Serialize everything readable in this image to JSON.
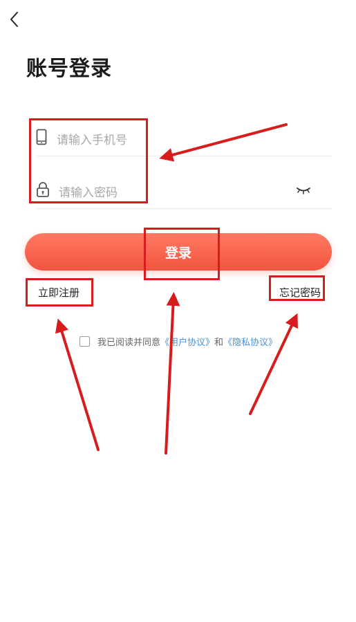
{
  "header": {
    "back_icon": "chevron-left-icon"
  },
  "title": "账号登录",
  "phone": {
    "icon": "mobile-phone-icon",
    "placeholder": "请输入手机号"
  },
  "password": {
    "icon": "lock-icon",
    "placeholder": "请输入密码",
    "toggle_icon": "eye-closed-icon"
  },
  "login_label": "登录",
  "register_label": "立即注册",
  "forgot_label": "忘记密码",
  "agreement": {
    "prefix": "我已阅读并同意",
    "user_agreement": "《用户协议》",
    "and": "和",
    "privacy_policy": "《隐私协议》"
  },
  "colors": {
    "accent": "#f2533f",
    "link": "#4a90d9",
    "annotation": "#d61c1c"
  }
}
